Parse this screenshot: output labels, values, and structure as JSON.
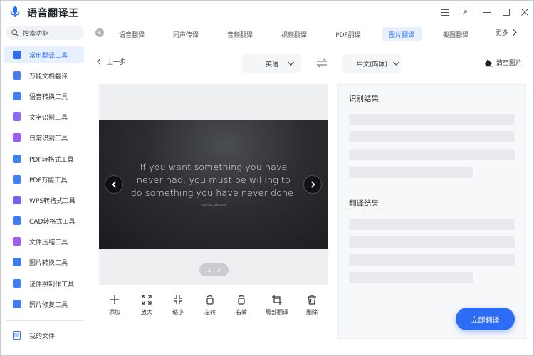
{
  "app": {
    "title": "语音翻译王"
  },
  "window_controls": [
    "menu-icon",
    "pin-icon",
    "minimize-icon",
    "maximize-icon",
    "close-icon"
  ],
  "sidebar": {
    "search_label": "搜索功能",
    "items": [
      {
        "label": "常用翻译工具",
        "icon": "translate-icon",
        "color": "#2d6df6",
        "active": true
      },
      {
        "label": "万能文档翻译",
        "icon": "document-icon",
        "color": "#4b7bec",
        "active": false
      },
      {
        "label": "语音转换工具",
        "icon": "voice-icon",
        "color": "#3d7ef7",
        "active": false
      },
      {
        "label": "文字识别工具",
        "icon": "ocr-icon",
        "color": "#8b6cf0",
        "active": false
      },
      {
        "label": "日常识别工具",
        "icon": "scan-icon",
        "color": "#9b59f5",
        "active": false
      },
      {
        "label": "PDF转格式工具",
        "icon": "pdf-convert-icon",
        "color": "#3b82f6",
        "active": false
      },
      {
        "label": "PDF万能工具",
        "icon": "pdf-tool-icon",
        "color": "#3b82f6",
        "active": false
      },
      {
        "label": "WPS转格式工具",
        "icon": "wps-icon",
        "color": "#7c5cf0",
        "active": false
      },
      {
        "label": "CAD转格式工具",
        "icon": "cad-icon",
        "color": "#3d7ef7",
        "active": false
      },
      {
        "label": "文件压缩工具",
        "icon": "compress-icon",
        "color": "#a35cf0",
        "active": false
      },
      {
        "label": "图片转换工具",
        "icon": "image-convert-icon",
        "color": "#3d7ef7",
        "active": false
      },
      {
        "label": "证件照制作工具",
        "icon": "id-photo-icon",
        "color": "#3d7ef7",
        "active": false
      },
      {
        "label": "照片修复工具",
        "icon": "photo-repair-icon",
        "color": "#3d7ef7",
        "active": false
      }
    ],
    "my_files": "我的文件"
  },
  "tabs": [
    {
      "label": "语音翻译",
      "active": false
    },
    {
      "label": "同声传译",
      "active": false
    },
    {
      "label": "音频翻译",
      "active": false
    },
    {
      "label": "视频翻译",
      "active": false
    },
    {
      "label": "PDF翻译",
      "active": false
    },
    {
      "label": "图片翻译",
      "active": true
    },
    {
      "label": "截图翻译",
      "active": false
    }
  ],
  "more_label": "更多",
  "toolbar": {
    "back_label": "上一步",
    "source_lang": "英语",
    "target_lang": "中文(简体)",
    "clear_label": "清空图片"
  },
  "image": {
    "quote_lines": [
      "If you want something you have",
      "never had, you must be willing to",
      "do something you have never done."
    ],
    "author": "Thomas Jefferson",
    "pager": "1 / 3"
  },
  "tools": [
    {
      "label": "添加",
      "icon": "plus-icon"
    },
    {
      "label": "放大",
      "icon": "zoom-in-icon"
    },
    {
      "label": "缩小",
      "icon": "zoom-out-icon"
    },
    {
      "label": "左转",
      "icon": "rotate-left-icon"
    },
    {
      "label": "右转",
      "icon": "rotate-right-icon"
    },
    {
      "label": "局部翻译",
      "icon": "crop-icon"
    },
    {
      "label": "删除",
      "icon": "trash-icon"
    }
  ],
  "results": {
    "recognize_title": "识别结果",
    "translate_title": "翻译结果",
    "translate_button": "立即翻译"
  },
  "colors": {
    "accent": "#2d6df6",
    "active_bg": "#e8f0fe"
  }
}
